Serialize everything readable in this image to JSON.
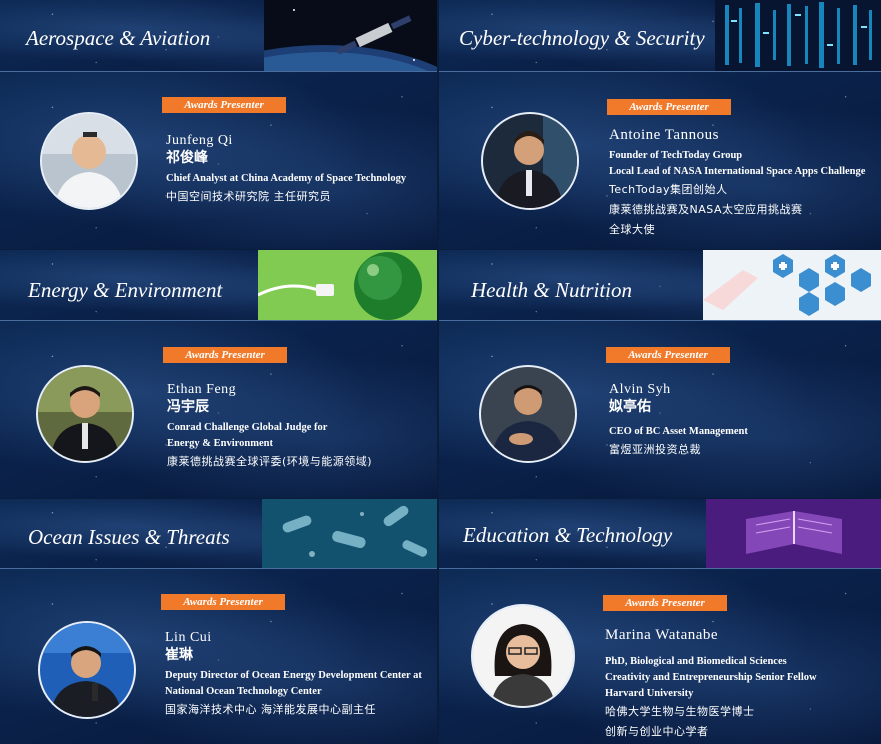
{
  "badge_label": "Awards Presenter",
  "colors": {
    "badge": "#f07a2a",
    "background": "#0a2149",
    "divider": "#4b6d9e"
  },
  "sections": [
    {
      "category": "Aerospace & Aviation",
      "image": "satellite-over-earth-image",
      "presenter": {
        "name": "Junfeng Qi",
        "name_cn": "祁俊峰",
        "roles": [
          "Chief Analyst at China Academy of Space Technology"
        ],
        "roles_cn": [
          "中国空间技术研究院  主任研究员"
        ]
      }
    },
    {
      "category": "Cyber-technology & Security",
      "image": "server-rack-image",
      "presenter": {
        "name": "Antoine Tannous",
        "name_cn": "",
        "roles": [
          "Founder of TechToday Group",
          "Local Lead of NASA International Space Apps Challenge"
        ],
        "roles_cn": [
          "TechToday集团创始人",
          "康莱德挑战赛及NASA太空应用挑战赛",
          "全球大使"
        ]
      }
    },
    {
      "category": "Energy & Environment",
      "image": "green-earth-plug-image",
      "presenter": {
        "name": "Ethan Feng",
        "name_cn": "冯宇辰",
        "roles": [
          "Conrad Challenge Global Judge for",
          "Energy & Environment"
        ],
        "roles_cn": [
          "康莱德挑战赛全球评委(环境与能源领域)"
        ]
      }
    },
    {
      "category": "Health & Nutrition",
      "image": "medical-icons-image",
      "presenter": {
        "name": "Alvin Syh",
        "name_cn": "姒亭佑",
        "roles": [
          "CEO of BC Asset Management"
        ],
        "roles_cn": [
          "富煜亚洲投资总裁"
        ]
      }
    },
    {
      "category": "Ocean Issues & Threats",
      "image": "ocean-plastic-bottles-image",
      "presenter": {
        "name": "Lin Cui",
        "name_cn": "崔琳",
        "roles": [
          "Deputy Director of Ocean Energy Development Center at",
          "National Ocean Technology Center"
        ],
        "roles_cn": [
          "国家海洋技术中心  海洋能发展中心副主任"
        ]
      }
    },
    {
      "category": "Education & Technology",
      "image": "glowing-book-image",
      "presenter": {
        "name": "Marina Watanabe",
        "name_cn": "",
        "roles": [
          "PhD, Biological and Biomedical Sciences",
          "Creativity and Entrepreneurship Senior Fellow",
          "Harvard University"
        ],
        "roles_cn": [
          "哈佛大学生物与生物医学博士",
          "创新与创业中心学者"
        ]
      }
    }
  ]
}
